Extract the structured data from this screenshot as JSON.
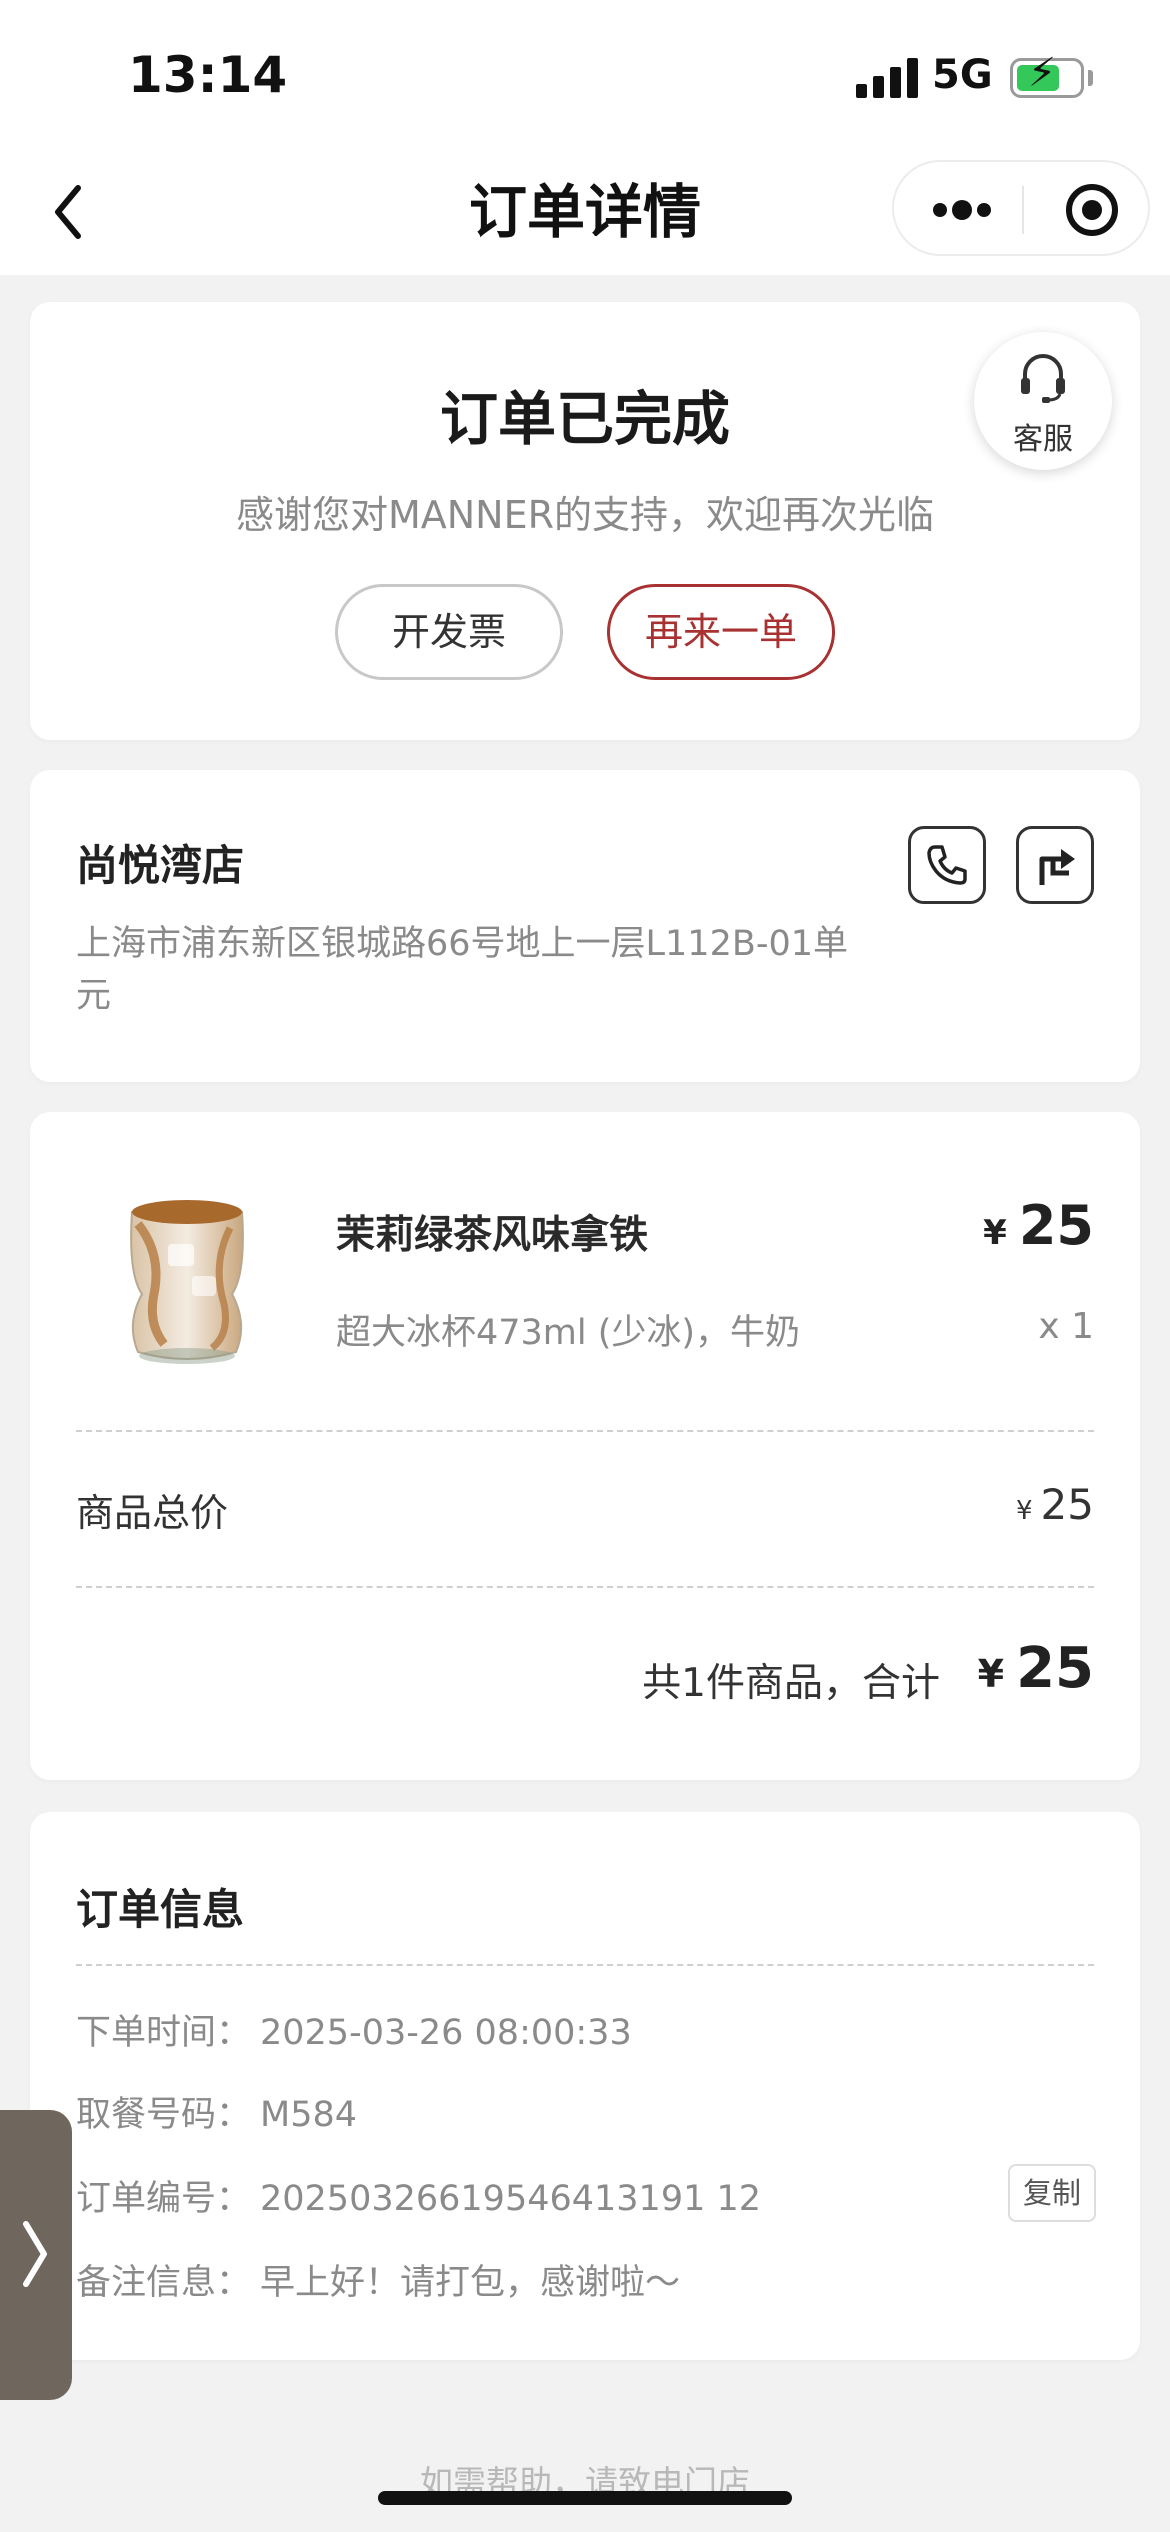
{
  "status_bar": {
    "time": "13:14",
    "network": "5G"
  },
  "nav": {
    "title": "订单详情"
  },
  "order_status": {
    "title": "订单已完成",
    "subtitle": "感谢您对MANNER的支持，欢迎再次光临",
    "invoice_label": "开发票",
    "reorder_label": "再来一单",
    "customer_service_label": "客服"
  },
  "store": {
    "name": "尚悦湾店",
    "address": "上海市浦东新区银城路66号地上一层L112B-01单元"
  },
  "product": {
    "name": "茉莉绿茶风味拿铁",
    "options": "超大冰杯473ml (少冰)，牛奶",
    "currency": "¥",
    "price": "25",
    "quantity": "x 1"
  },
  "summary": {
    "subtotal_label": "商品总价",
    "subtotal_currency": "¥",
    "subtotal_value": "25",
    "total_label": "共1件商品，合计",
    "total_currency": "¥",
    "total_value": "25"
  },
  "order_info": {
    "title": "订单信息",
    "rows": [
      {
        "key": "下单时间：",
        "value": "2025-03-26 08:00:33"
      },
      {
        "key": "取餐号码：",
        "value": "M584"
      },
      {
        "key": "订单编号：",
        "value": "20250326619546413191 12"
      },
      {
        "key": "备注信息：",
        "value": "早上好！请打包，感谢啦～"
      }
    ],
    "copy_label": "复制"
  },
  "footer": {
    "hint": "如需帮助，请致电门店"
  },
  "icons": {
    "back": "chevron-left-icon",
    "more": "more-dots-icon",
    "close_target": "target-icon",
    "headset": "headset-icon",
    "phone": "phone-icon",
    "directions": "directions-icon",
    "side_chevron": "chevron-right-icon"
  },
  "colors": {
    "accent": "#a83232",
    "battery": "#34c759"
  }
}
